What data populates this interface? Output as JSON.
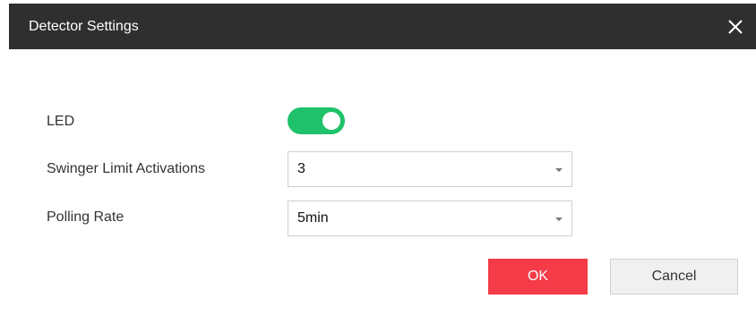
{
  "dialog": {
    "title": "Detector Settings",
    "close_icon": "close-icon"
  },
  "form": {
    "led": {
      "label": "LED",
      "enabled": true,
      "toggle_color": "#1fc26a"
    },
    "swinger_limit": {
      "label": "Swinger Limit Activations",
      "value": "3"
    },
    "polling_rate": {
      "label": "Polling Rate",
      "value": "5min"
    }
  },
  "buttons": {
    "ok_label": "OK",
    "ok_color": "#f53b47",
    "cancel_label": "Cancel"
  }
}
